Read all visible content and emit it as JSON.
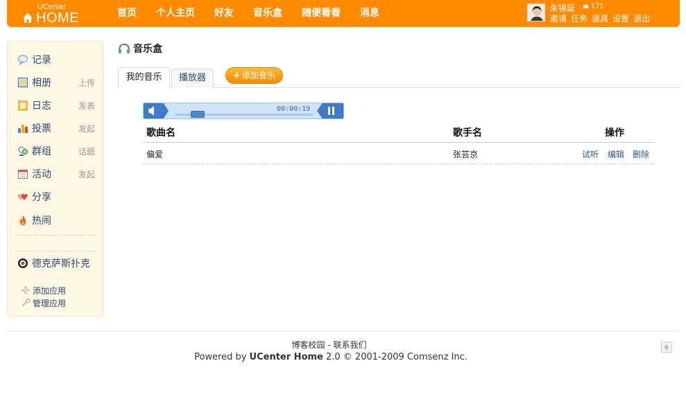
{
  "header": {
    "logo_small": "UCenter",
    "logo_big": "HOME",
    "nav": [
      "首页",
      "个人主页",
      "好友",
      "音乐盒",
      "随便看看",
      "消息"
    ],
    "user": {
      "name": "朱锦延",
      "credit": "171",
      "links": [
        "邀请",
        "任务",
        "道具",
        "设置",
        "退出"
      ]
    }
  },
  "sidebar": {
    "items": [
      {
        "label": "记录",
        "sub": "",
        "icon": "speech-bubble-icon"
      },
      {
        "label": "相册",
        "sub": "上传",
        "icon": "photo-icon"
      },
      {
        "label": "日志",
        "sub": "发表",
        "icon": "notebook-icon"
      },
      {
        "label": "投票",
        "sub": "发起",
        "icon": "bar-chart-icon"
      },
      {
        "label": "群组",
        "sub": "话题",
        "icon": "group-icon"
      },
      {
        "label": "活动",
        "sub": "发起",
        "icon": "calendar-icon"
      },
      {
        "label": "分享",
        "sub": "",
        "icon": "hearts-icon"
      },
      {
        "label": "热闹",
        "sub": "",
        "icon": "fire-icon"
      }
    ],
    "app": {
      "label": "德克萨斯扑克",
      "icon": "poker-chip-icon"
    },
    "add_app": "添加应用",
    "manage_app": "管理应用"
  },
  "main": {
    "title": "音乐盒",
    "tabs": [
      "我的音乐",
      "播放器"
    ],
    "add_button": "添加音乐",
    "player": {
      "time": "00:00:19",
      "progress": 0.09
    },
    "table": {
      "headers": [
        "歌曲名",
        "歌手名",
        "操作"
      ],
      "rows": [
        {
          "song": "偏爱",
          "artist": "张芸京",
          "actions": [
            "试听",
            "编辑",
            "删除"
          ]
        }
      ]
    }
  },
  "footer": {
    "link1": "博客校园",
    "sep": " - ",
    "link2": "联系我们",
    "powered_prefix": "Powered by ",
    "powered_brand": "UCenter Home",
    "powered_suffix": " 2.0 © 2001-2009 Comsenz Inc."
  },
  "colors": {
    "accent": "#ff8a00",
    "link": "#2b4a7a",
    "sidebar_bg": "#fdf7e3",
    "player_blue": "#3d7cc8"
  }
}
